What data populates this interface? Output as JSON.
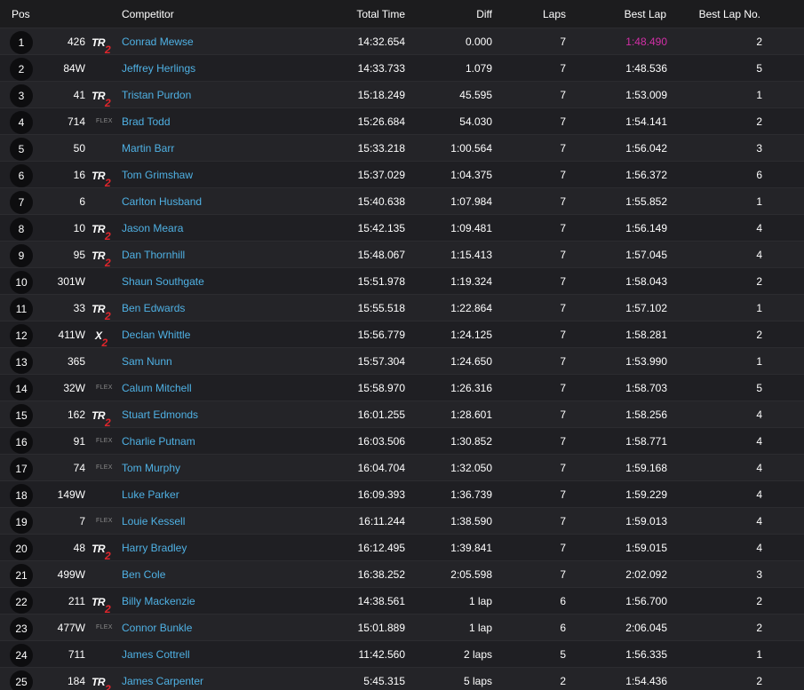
{
  "header": {
    "pos": "Pos",
    "competitor": "Competitor",
    "total_time": "Total Time",
    "diff": "Diff",
    "laps": "Laps",
    "best_lap": "Best Lap",
    "best_lap_no": "Best Lap No."
  },
  "colors": {
    "background": "#1c1c1e",
    "name_link": "#4fb1e4",
    "fastest_lap": "#d12fa6",
    "class_red": "#e0262c"
  },
  "rows": [
    {
      "pos": "1",
      "number": "426",
      "cls": "TR2",
      "name": "Conrad Mewse",
      "total": "14:32.654",
      "diff": "0.000",
      "laps": "7",
      "best": "1:48.490",
      "best_no": "2",
      "fastest": true
    },
    {
      "pos": "2",
      "number": "84W",
      "cls": "",
      "name": "Jeffrey Herlings",
      "total": "14:33.733",
      "diff": "1.079",
      "laps": "7",
      "best": "1:48.536",
      "best_no": "5"
    },
    {
      "pos": "3",
      "number": "41",
      "cls": "TR2",
      "name": "Tristan Purdon",
      "total": "15:18.249",
      "diff": "45.595",
      "laps": "7",
      "best": "1:53.009",
      "best_no": "1"
    },
    {
      "pos": "4",
      "number": "714",
      "cls": "FLEX",
      "name": "Brad Todd",
      "total": "15:26.684",
      "diff": "54.030",
      "laps": "7",
      "best": "1:54.141",
      "best_no": "2"
    },
    {
      "pos": "5",
      "number": "50",
      "cls": "",
      "name": "Martin Barr",
      "total": "15:33.218",
      "diff": "1:00.564",
      "laps": "7",
      "best": "1:56.042",
      "best_no": "3"
    },
    {
      "pos": "6",
      "number": "16",
      "cls": "TR2",
      "name": "Tom Grimshaw",
      "total": "15:37.029",
      "diff": "1:04.375",
      "laps": "7",
      "best": "1:56.372",
      "best_no": "6"
    },
    {
      "pos": "7",
      "number": "6",
      "cls": "",
      "name": "Carlton Husband",
      "total": "15:40.638",
      "diff": "1:07.984",
      "laps": "7",
      "best": "1:55.852",
      "best_no": "1"
    },
    {
      "pos": "8",
      "number": "10",
      "cls": "TR2",
      "name": "Jason Meara",
      "total": "15:42.135",
      "diff": "1:09.481",
      "laps": "7",
      "best": "1:56.149",
      "best_no": "4"
    },
    {
      "pos": "9",
      "number": "95",
      "cls": "TR2",
      "name": "Dan Thornhill",
      "total": "15:48.067",
      "diff": "1:15.413",
      "laps": "7",
      "best": "1:57.045",
      "best_no": "4"
    },
    {
      "pos": "10",
      "number": "301W",
      "cls": "",
      "name": "Shaun Southgate",
      "total": "15:51.978",
      "diff": "1:19.324",
      "laps": "7",
      "best": "1:58.043",
      "best_no": "2"
    },
    {
      "pos": "11",
      "number": "33",
      "cls": "TR2",
      "name": "Ben Edwards",
      "total": "15:55.518",
      "diff": "1:22.864",
      "laps": "7",
      "best": "1:57.102",
      "best_no": "1"
    },
    {
      "pos": "12",
      "number": "411W",
      "cls": "X2",
      "name": "Declan Whittle",
      "total": "15:56.779",
      "diff": "1:24.125",
      "laps": "7",
      "best": "1:58.281",
      "best_no": "2"
    },
    {
      "pos": "13",
      "number": "365",
      "cls": "",
      "name": "Sam Nunn",
      "total": "15:57.304",
      "diff": "1:24.650",
      "laps": "7",
      "best": "1:53.990",
      "best_no": "1"
    },
    {
      "pos": "14",
      "number": "32W",
      "cls": "FLEX",
      "name": "Calum Mitchell",
      "total": "15:58.970",
      "diff": "1:26.316",
      "laps": "7",
      "best": "1:58.703",
      "best_no": "5"
    },
    {
      "pos": "15",
      "number": "162",
      "cls": "TR2",
      "name": "Stuart Edmonds",
      "total": "16:01.255",
      "diff": "1:28.601",
      "laps": "7",
      "best": "1:58.256",
      "best_no": "4"
    },
    {
      "pos": "16",
      "number": "91",
      "cls": "FLEX",
      "name": "Charlie Putnam",
      "total": "16:03.506",
      "diff": "1:30.852",
      "laps": "7",
      "best": "1:58.771",
      "best_no": "4"
    },
    {
      "pos": "17",
      "number": "74",
      "cls": "FLEX",
      "name": "Tom Murphy",
      "total": "16:04.704",
      "diff": "1:32.050",
      "laps": "7",
      "best": "1:59.168",
      "best_no": "4"
    },
    {
      "pos": "18",
      "number": "149W",
      "cls": "",
      "name": "Luke Parker",
      "total": "16:09.393",
      "diff": "1:36.739",
      "laps": "7",
      "best": "1:59.229",
      "best_no": "4"
    },
    {
      "pos": "19",
      "number": "7",
      "cls": "FLEX",
      "name": "Louie Kessell",
      "total": "16:11.244",
      "diff": "1:38.590",
      "laps": "7",
      "best": "1:59.013",
      "best_no": "4"
    },
    {
      "pos": "20",
      "number": "48",
      "cls": "TR2",
      "name": "Harry Bradley",
      "total": "16:12.495",
      "diff": "1:39.841",
      "laps": "7",
      "best": "1:59.015",
      "best_no": "4"
    },
    {
      "pos": "21",
      "number": "499W",
      "cls": "",
      "name": "Ben Cole",
      "total": "16:38.252",
      "diff": "2:05.598",
      "laps": "7",
      "best": "2:02.092",
      "best_no": "3"
    },
    {
      "pos": "22",
      "number": "211",
      "cls": "TR2",
      "name": "Billy Mackenzie",
      "total": "14:38.561",
      "diff": "1 lap",
      "laps": "6",
      "best": "1:56.700",
      "best_no": "2"
    },
    {
      "pos": "23",
      "number": "477W",
      "cls": "FLEX",
      "name": "Connor Bunkle",
      "total": "15:01.889",
      "diff": "1 lap",
      "laps": "6",
      "best": "2:06.045",
      "best_no": "2"
    },
    {
      "pos": "24",
      "number": "711",
      "cls": "",
      "name": "James Cottrell",
      "total": "11:42.560",
      "diff": "2 laps",
      "laps": "5",
      "best": "1:56.335",
      "best_no": "1"
    },
    {
      "pos": "25",
      "number": "184",
      "cls": "TR2",
      "name": "James Carpenter",
      "total": "5:45.315",
      "diff": "5 laps",
      "laps": "2",
      "best": "1:54.436",
      "best_no": "2"
    }
  ]
}
